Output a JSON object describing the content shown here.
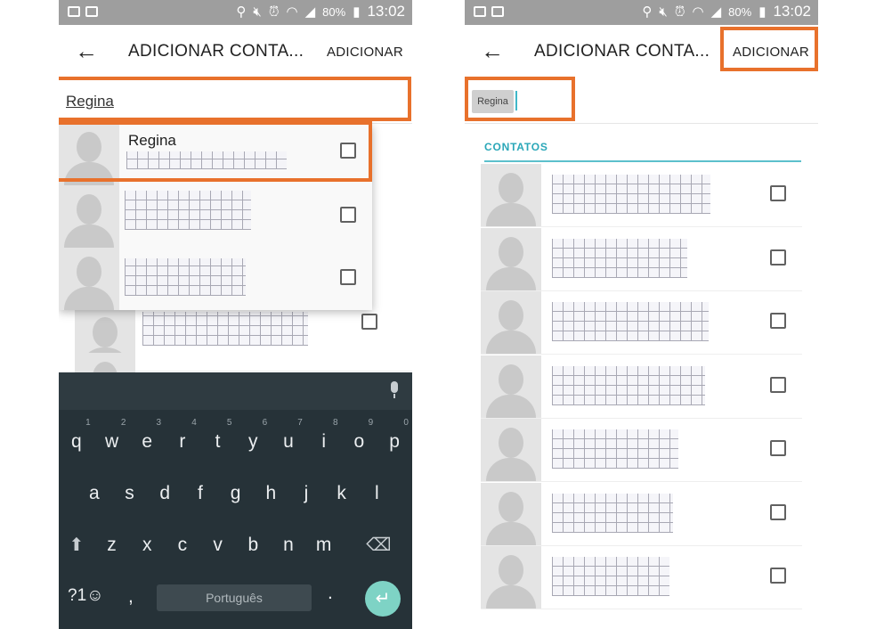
{
  "status_bar": {
    "icons": [
      "image-icon",
      "voicemail-icon",
      "location-icon",
      "mute-icon",
      "alarm-icon",
      "wifi-icon",
      "signal-icon",
      "battery-icon"
    ],
    "battery": "80%",
    "time": "13:02"
  },
  "app_bar": {
    "back_icon": "arrow-left-icon",
    "back_glyph": "←",
    "title": "ADICIONAR CONTA...",
    "action": "ADICIONAR"
  },
  "left": {
    "search_value": "Regina",
    "suggestion": {
      "name": "Regina"
    },
    "keyboard": {
      "row1": [
        {
          "key": "q",
          "hint": "1"
        },
        {
          "key": "w",
          "hint": "2"
        },
        {
          "key": "e",
          "hint": "3"
        },
        {
          "key": "r",
          "hint": "4"
        },
        {
          "key": "t",
          "hint": "5"
        },
        {
          "key": "y",
          "hint": "6"
        },
        {
          "key": "u",
          "hint": "7"
        },
        {
          "key": "i",
          "hint": "8"
        },
        {
          "key": "o",
          "hint": "9"
        },
        {
          "key": "p",
          "hint": "0"
        }
      ],
      "row2": [
        "a",
        "s",
        "d",
        "f",
        "g",
        "h",
        "j",
        "k",
        "l"
      ],
      "row3": [
        "z",
        "x",
        "c",
        "v",
        "b",
        "n",
        "m"
      ],
      "shift_glyph": "⬆",
      "backspace_glyph": "⌫",
      "symbols_label": "?1☺",
      "comma": ",",
      "space_label": "Português",
      "period": ".",
      "enter_glyph": "↵"
    }
  },
  "right": {
    "chip_label": "Regina",
    "section_header": "CONTATOS"
  },
  "accent_colors": {
    "highlight": "#e8712c",
    "teal": "#2aa7b8"
  }
}
